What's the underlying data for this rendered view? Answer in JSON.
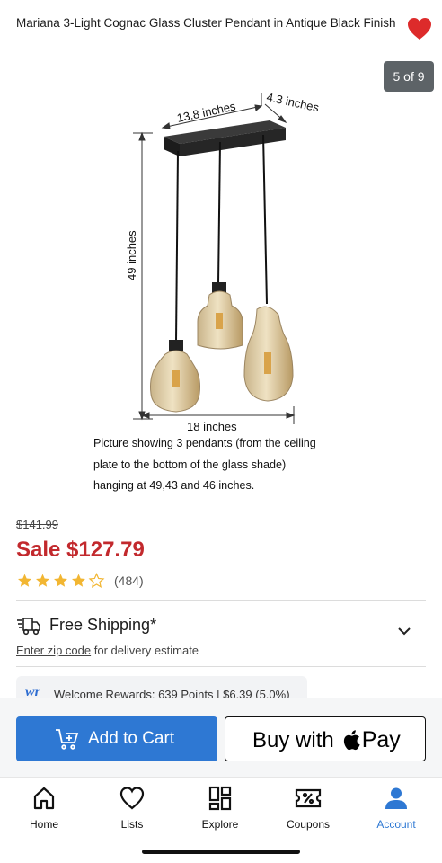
{
  "header": {
    "product_title": "Mariana 3-Light Cognac Glass Cluster Pendant in Antique Black Finish",
    "favorite_icon": "heart-icon"
  },
  "gallery": {
    "counter": "5 of 9",
    "image": {
      "dim_plate_width": "13.8 inches",
      "dim_plate_depth": "4.3 inches",
      "dim_height": "49 inches",
      "dim_span": "18 inches",
      "caption_lines": [
        "Picture showing 3 pendants (from the ceiling",
        "plate to the bottom of the glass shade)",
        "hanging at 49,43 and 46 inches."
      ]
    }
  },
  "pricing": {
    "original": "$141.99",
    "sale": "Sale $127.79",
    "rating_value": 4,
    "rating_max": 5,
    "review_count": "(484)"
  },
  "shipping": {
    "label": "Free Shipping*",
    "zip_link": "Enter zip code",
    "zip_suffix": " for delivery estimate"
  },
  "rewards": {
    "logo": "wr",
    "text": "Welcome Rewards: 639 Points | $6.39 (5.0%)"
  },
  "actions": {
    "add_to_cart": "Add to Cart",
    "buy_with": "Buy with",
    "pay": "Pay"
  },
  "tabs": [
    {
      "label": "Home",
      "icon": "home-icon"
    },
    {
      "label": "Lists",
      "icon": "heart-outline-icon"
    },
    {
      "label": "Explore",
      "icon": "grid-icon"
    },
    {
      "label": "Coupons",
      "icon": "coupon-icon"
    },
    {
      "label": "Account",
      "icon": "account-icon"
    }
  ],
  "colors": {
    "sale": "#c2292d",
    "primary": "#2e78d3",
    "star": "#f2b632",
    "heart": "#dd2b2b"
  }
}
